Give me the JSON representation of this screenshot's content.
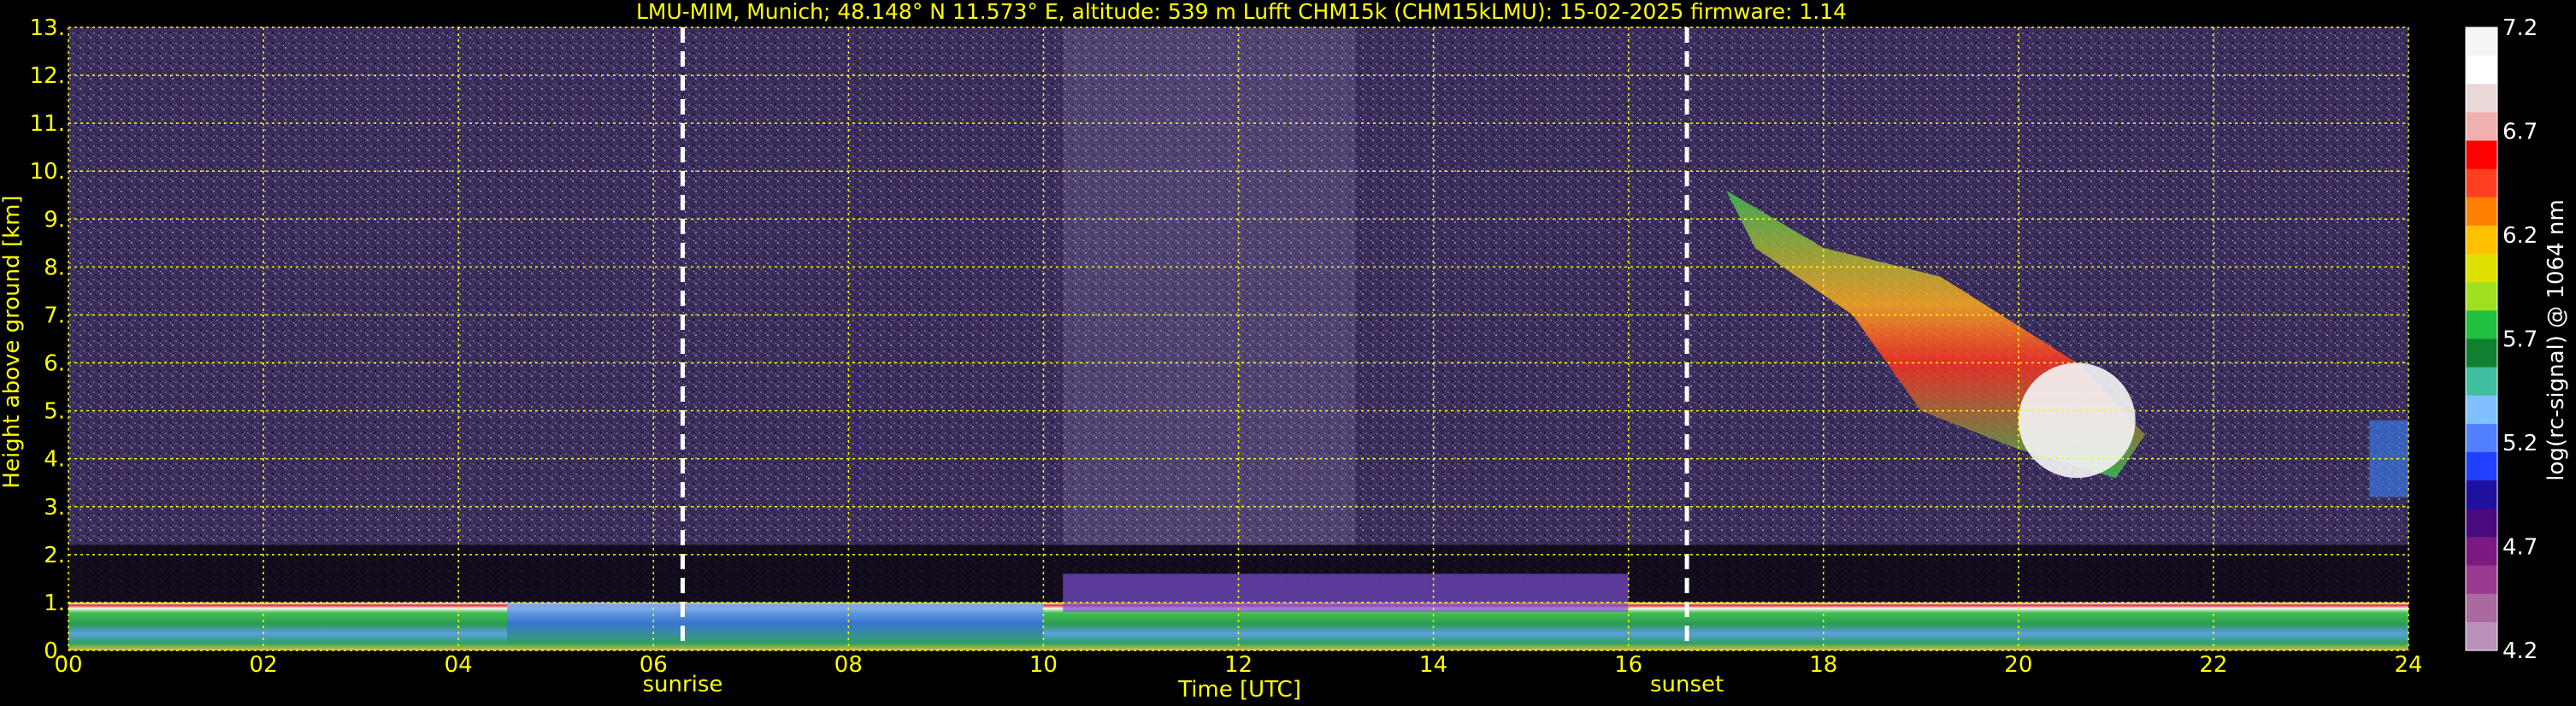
{
  "chart_data": {
    "type": "heatmap",
    "title": "LMU-MIM, Munich; 48.148° N 11.573° E, altitude: 539 m    Lufft CHM15k (CHM15kLMU): 15-02-2025    firmware: 1.14",
    "xlabel": "Time [UTC]",
    "ylabel": "Height above ground [km]",
    "xlim": [
      0,
      24
    ],
    "ylim": [
      0,
      13
    ],
    "xticks": [
      "00",
      "02",
      "04",
      "06",
      "08",
      "10",
      "12",
      "14",
      "16",
      "18",
      "20",
      "22",
      "24"
    ],
    "yticks": [
      "0.",
      "1.",
      "2.",
      "3.",
      "4.",
      "5.",
      "6.",
      "7.",
      "8.",
      "9.",
      "10.",
      "11.",
      "12.",
      "13."
    ],
    "grid": true,
    "events": [
      {
        "label": "sunrise",
        "time_utc": 6.3
      },
      {
        "label": "sunset",
        "time_utc": 16.6
      }
    ],
    "colorbar": {
      "label": "log(rc-signal) @ 1064 nm",
      "range": [
        4.2,
        7.2
      ],
      "ticks": [
        "4.2",
        "4.7",
        "5.2",
        "5.7",
        "6.2",
        "6.7",
        "7.2"
      ]
    },
    "features": [
      {
        "type": "boundary layer",
        "t_start": 0,
        "t_end": 24,
        "height_km": [
          0.0,
          1.0
        ]
      },
      {
        "type": "aerosol layer",
        "t_start": 10.2,
        "t_end": 16,
        "height_km": [
          0.8,
          1.6
        ]
      },
      {
        "type": "cirrus",
        "t_start": 17,
        "t_end": 21.3,
        "height_km": [
          3.6,
          9.6
        ]
      },
      {
        "type": "cloud",
        "t_start": 23.6,
        "t_end": 24,
        "height_km": [
          3.2,
          4.8
        ]
      }
    ]
  }
}
